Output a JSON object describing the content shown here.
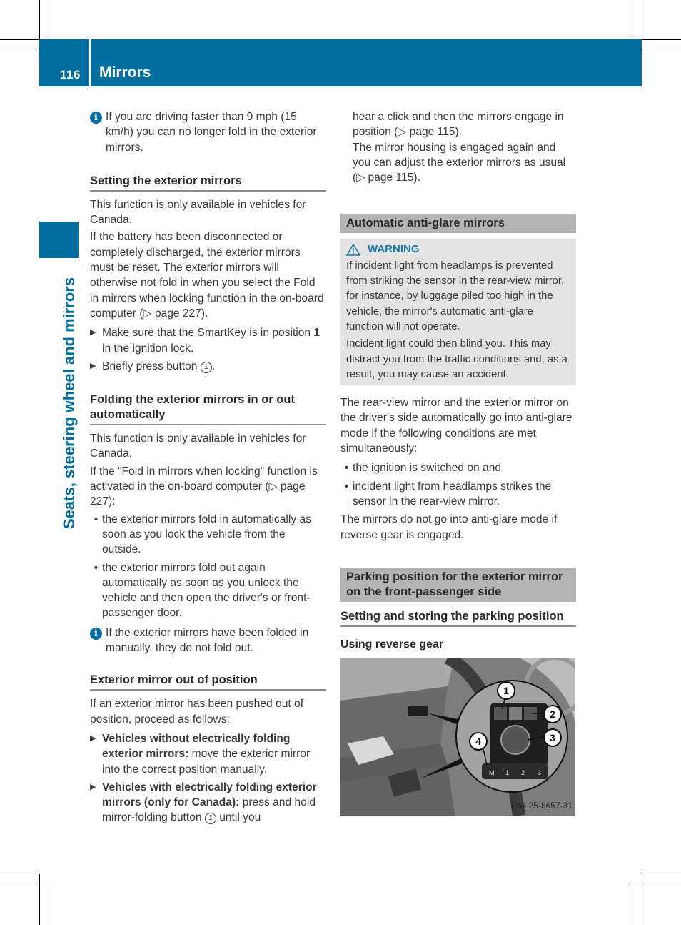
{
  "header": {
    "page_number": "116",
    "title": "Mirrors"
  },
  "side_tab": {
    "title": "Seats, steering wheel and mirrors"
  },
  "colors": {
    "brand_blue": "#006ea0",
    "section_grey": "#b4b4b4",
    "warning_bg": "#e3e3e3"
  },
  "left_column": {
    "info_1": "If you are driving faster than 9 mph (15 km/h) you can no longer fold in the exterior mirrors.",
    "section_setting": {
      "heading": "Setting the exterior mirrors",
      "para_1": "This function is only available in vehicles for Canada.",
      "para_2": "If the battery has been disconnected or completely discharged, the exterior mirrors must be reset. The exterior mirrors will otherwise not fold in when you select the Fold in mirrors when locking function in the on-board computer (▷ page 227).",
      "step_1_a": "Make sure that the SmartKey is in position ",
      "step_1_bold": "1",
      "step_1_b": " in the ignition lock.",
      "step_2_a": "Briefly press button ",
      "step_2_callout": "1",
      "step_2_b": "."
    },
    "section_folding": {
      "heading": "Folding the exterior mirrors in or out automatically",
      "para_1": "This function is only available in vehicles for Canada.",
      "para_2": "If the \"Fold in mirrors when locking\" function is activated in the on-board computer (▷ page 227):",
      "bullets": [
        "the exterior mirrors fold in automatically as soon as you lock the vehicle from the outside.",
        "the exterior mirrors fold out again automatically as soon as you unlock the vehicle and then open the driver's or front-passenger door."
      ],
      "info": "If the exterior mirrors have been folded in manually, they do not fold out."
    },
    "section_out_of_position": {
      "heading": "Exterior mirror out of position",
      "para_1": "If an exterior mirror has been pushed out of position, proceed as follows:",
      "step_1_bold": "Vehicles without electrically folding exterior mirrors:",
      "step_1_text": " move the exterior mirror into the correct position manually.",
      "step_2_bold": "Vehicles with electrically folding exterior mirrors (only for Canada):",
      "step_2_text_a": " press and hold mirror-folding button ",
      "step_2_callout": "1",
      "step_2_text_b": " until you"
    }
  },
  "right_column": {
    "continued_a": "hear a click and then the mirrors engage in position (▷ page 115).",
    "continued_b": "The mirror housing is engaged again and you can adjust the exterior mirrors as usual (▷ page 115).",
    "section_antiglare": {
      "heading": "Automatic anti-glare mirrors",
      "warning_label": "WARNING",
      "warning_para_1": "If incident light from headlamps is prevented from striking the sensor in the rear-view mirror, for instance, by luggage piled too high in the vehicle, the mirror's automatic anti-glare function will not operate.",
      "warning_para_2": "Incident light could then blind you. This may distract you from the traffic conditions and, as a result, you may cause an accident.",
      "para_1": "The rear-view mirror and the exterior mirror on the driver's side automatically go into anti-glare mode if the following conditions are met simultaneously:",
      "bullets": [
        "the ignition is switched on and",
        "incident light from headlamps strikes the sensor in the rear-view mirror."
      ],
      "para_2": "The mirrors do not go into anti-glare mode if reverse gear is engaged."
    },
    "section_parking": {
      "heading": "Parking position for the exterior mirror on the front-passenger side",
      "subheading": "Setting and storing the parking position",
      "subsubheading": "Using reverse gear",
      "figure": {
        "caption": "P54.25-8657-31",
        "callouts": [
          "1",
          "2",
          "3",
          "4"
        ],
        "memory_buttons": [
          "M",
          "1",
          "2",
          "3"
        ]
      }
    }
  }
}
